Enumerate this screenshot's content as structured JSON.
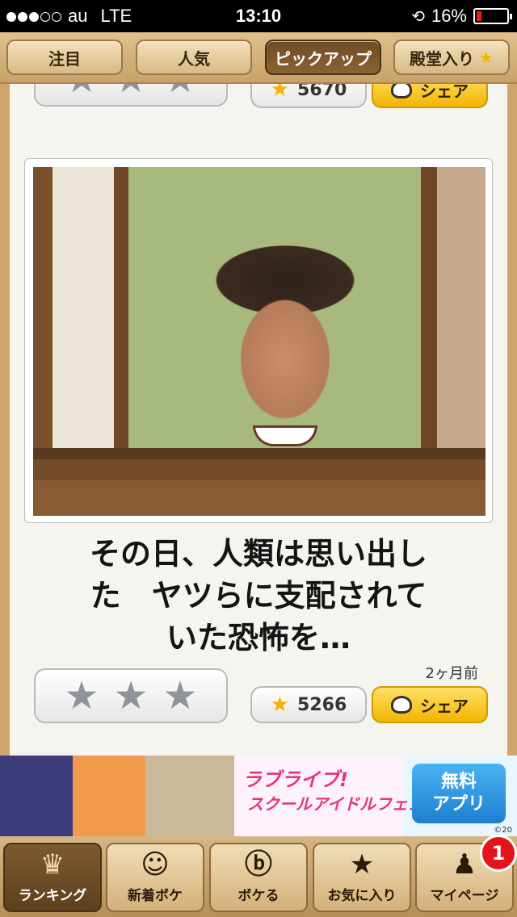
{
  "status_bar": {
    "carrier": "au",
    "network": "LTE",
    "time": "13:10",
    "battery": "16%",
    "battery_level": 0.16
  },
  "top_tabs": [
    {
      "label": "注目",
      "active": false
    },
    {
      "label": "人気",
      "active": false
    },
    {
      "label": "ピックアップ",
      "active": true
    },
    {
      "label": "殿堂入り",
      "active": false,
      "icon": "star-icon"
    }
  ],
  "previous_post": {
    "rating_icon": "star-outline-icon",
    "count": "5670",
    "share_label": "シェア"
  },
  "post": {
    "caption": "その日、人類は思い出し\nた　ヤツらに支配されて\nいた恐怖を…",
    "time_ago": "2ヶ月前",
    "rating_stars": 3,
    "count": "5266",
    "share_label": "シェア"
  },
  "ad": {
    "title": "ラブライブ!",
    "subtitle": "スクールアイドルフェスティバル",
    "cta_line1": "無料",
    "cta_line2": "アプリ",
    "copyright": "©20"
  },
  "bottom_tabs": [
    {
      "label": "ランキング",
      "icon": "crown-icon",
      "active": true
    },
    {
      "label": "新着ボケ",
      "icon": "face-icon",
      "active": false
    },
    {
      "label": "ボケる",
      "icon": "boke-icon",
      "active": false
    },
    {
      "label": "お気に入り",
      "icon": "star-icon",
      "active": false
    },
    {
      "label": "マイページ",
      "icon": "user-icon",
      "active": false,
      "badge": "1"
    }
  ],
  "colors": {
    "accent_gold": "#f3b500",
    "active_tab": "#6e4b25",
    "badge_red": "#e4141b"
  }
}
